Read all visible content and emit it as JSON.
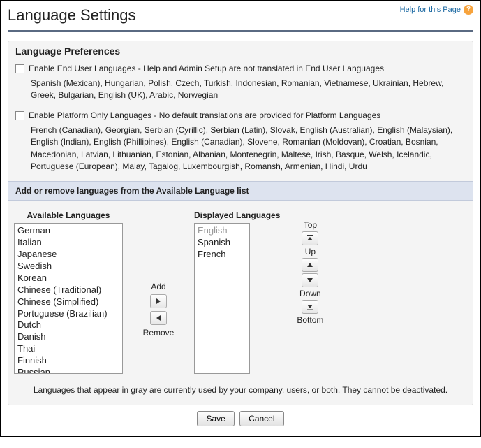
{
  "header": {
    "title": "Language Settings",
    "help_text": "Help for this Page"
  },
  "prefs": {
    "section_title": "Language Preferences",
    "end_user": {
      "label": "Enable End User Languages - Help and Admin Setup are not translated in End User Languages",
      "list": "Spanish (Mexican), Hungarian, Polish, Czech, Turkish, Indonesian, Romanian, Vietnamese, Ukrainian, Hebrew, Greek, Bulgarian, English (UK), Arabic, Norwegian"
    },
    "platform": {
      "label": "Enable Platform Only Languages - No default translations are provided for Platform Languages",
      "list": "French (Canadian), Georgian, Serbian (Cyrillic), Serbian (Latin), Slovak, English (Australian), English (Malaysian), English (Indian), English (Phillipines), English (Canadian), Slovene, Romanian (Moldovan), Croatian, Bosnian, Macedonian, Latvian, Lithuanian, Estonian, Albanian, Montenegrin, Maltese, Irish, Basque, Welsh, Icelandic, Portuguese (European), Malay, Tagalog, Luxembourgish, Romansh, Armenian, Hindi, Urdu"
    }
  },
  "picker": {
    "bar_title": "Add or remove languages from the Available Language list",
    "available_title": "Available Languages",
    "displayed_title": "Displayed Languages",
    "available": [
      "German",
      "Italian",
      "Japanese",
      "Swedish",
      "Korean",
      "Chinese (Traditional)",
      "Chinese (Simplified)",
      "Portuguese (Brazilian)",
      "Dutch",
      "Danish",
      "Thai",
      "Finnish",
      "Russian"
    ],
    "displayed": [
      {
        "label": "English",
        "gray": true
      },
      {
        "label": "Spanish",
        "gray": false
      },
      {
        "label": "French",
        "gray": false
      }
    ],
    "add_label": "Add",
    "remove_label": "Remove",
    "top_label": "Top",
    "up_label": "Up",
    "down_label": "Down",
    "bottom_label": "Bottom",
    "note": "Languages that appear in gray are currently used by your company, users, or both. They cannot be deactivated."
  },
  "buttons": {
    "save": "Save",
    "cancel": "Cancel"
  }
}
